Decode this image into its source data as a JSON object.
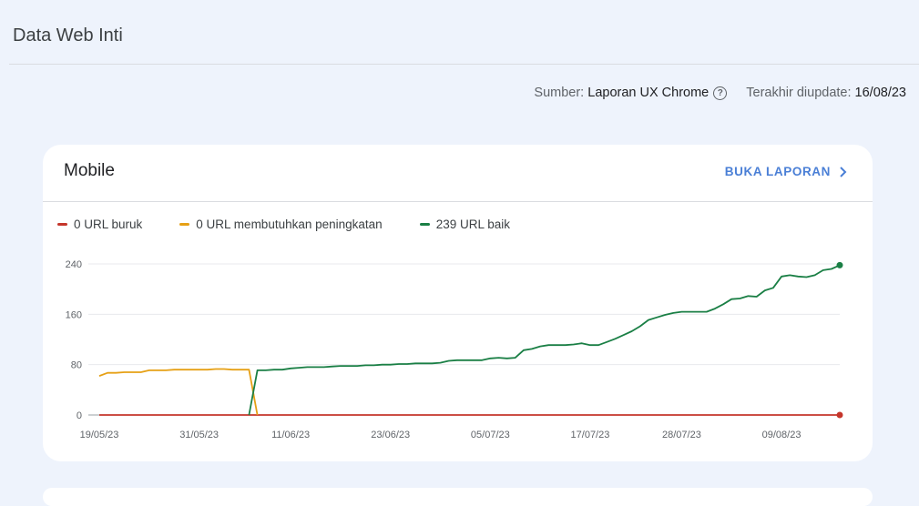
{
  "page": {
    "title": "Data Web Inti"
  },
  "meta": {
    "source_label": "Sumber:",
    "source_value": "Laporan UX Chrome",
    "updated_label": "Terakhir diupdate:",
    "updated_value": "16/08/23"
  },
  "card": {
    "title": "Mobile",
    "open_report_label": "BUKA LAPORAN",
    "legend": [
      {
        "label": "0 URL buruk",
        "color": "#c5362b"
      },
      {
        "label": "0 URL membutuhkan peningkatan",
        "color": "#e6a015"
      },
      {
        "label": "239 URL baik",
        "color": "#1a7f45"
      }
    ]
  },
  "chart_data": {
    "type": "line",
    "ylim": [
      0,
      240
    ],
    "yticks": [
      0,
      80,
      160,
      240
    ],
    "xtick_labels": [
      "19/05/23",
      "31/05/23",
      "11/06/23",
      "23/06/23",
      "05/07/23",
      "17/07/23",
      "28/07/23",
      "09/08/23"
    ],
    "xtick_days": [
      0,
      12,
      23,
      35,
      47,
      59,
      70,
      82
    ],
    "x_days": [
      0,
      1,
      2,
      3,
      4,
      5,
      6,
      7,
      8,
      9,
      10,
      11,
      12,
      13,
      14,
      15,
      16,
      17,
      18,
      19,
      20,
      21,
      22,
      23,
      24,
      25,
      26,
      27,
      28,
      29,
      30,
      31,
      32,
      33,
      34,
      35,
      36,
      37,
      38,
      39,
      40,
      41,
      42,
      43,
      44,
      45,
      46,
      47,
      48,
      49,
      50,
      51,
      52,
      53,
      54,
      55,
      56,
      57,
      58,
      59,
      60,
      61,
      62,
      63,
      64,
      65,
      66,
      67,
      68,
      69,
      70,
      71,
      72,
      73,
      74,
      75,
      76,
      77,
      78,
      79,
      80,
      81,
      82,
      83,
      84,
      85,
      86,
      87,
      88,
      89
    ],
    "series": [
      {
        "name": "0 URL buruk",
        "color": "#c5362b",
        "values": [
          0,
          0,
          0,
          0,
          0,
          0,
          0,
          0,
          0,
          0,
          0,
          0,
          0,
          0,
          0,
          0,
          0,
          0,
          0,
          0,
          0,
          0,
          0,
          0,
          0,
          0,
          0,
          0,
          0,
          0,
          0,
          0,
          0,
          0,
          0,
          0,
          0,
          0,
          0,
          0,
          0,
          0,
          0,
          0,
          0,
          0,
          0,
          0,
          0,
          0,
          0,
          0,
          0,
          0,
          0,
          0,
          0,
          0,
          0,
          0,
          0,
          0,
          0,
          0,
          0,
          0,
          0,
          0,
          0,
          0,
          0,
          0,
          0,
          0,
          0,
          0,
          0,
          0,
          0,
          0,
          0,
          0,
          0,
          0,
          0,
          0,
          0,
          0,
          0,
          0
        ]
      },
      {
        "name": "0 URL membutuhkan peningkatan",
        "color": "#e6a015",
        "values": [
          62,
          67,
          67,
          68,
          68,
          68,
          71,
          71,
          71,
          72,
          72,
          72,
          72,
          72,
          73,
          73,
          72,
          72,
          72,
          0,
          null,
          null,
          null,
          null,
          null,
          null,
          null,
          null,
          null,
          null,
          null,
          null,
          null,
          null,
          null,
          null,
          null,
          null,
          null,
          null,
          null,
          null,
          null,
          null,
          null,
          null,
          null,
          null,
          null,
          null,
          null,
          null,
          null,
          null,
          null,
          null,
          null,
          null,
          null,
          null,
          null,
          null,
          null,
          null,
          null,
          null,
          null,
          null,
          null,
          null,
          null,
          null,
          null,
          null,
          null,
          null,
          null,
          null,
          null,
          null,
          null,
          null,
          null,
          null,
          null,
          null,
          null,
          null,
          null,
          null
        ]
      },
      {
        "name": "239 URL baik",
        "color": "#1a7f45",
        "values": [
          null,
          null,
          null,
          null,
          null,
          null,
          null,
          null,
          null,
          null,
          null,
          null,
          null,
          null,
          null,
          null,
          null,
          null,
          0,
          71,
          71,
          72,
          72,
          74,
          75,
          76,
          76,
          76,
          77,
          78,
          78,
          78,
          79,
          79,
          80,
          80,
          81,
          81,
          82,
          82,
          82,
          83,
          86,
          87,
          87,
          87,
          87,
          90,
          91,
          90,
          91,
          103,
          105,
          109,
          111,
          111,
          111,
          112,
          114,
          111,
          111,
          116,
          121,
          127,
          133,
          141,
          151,
          155,
          159,
          162,
          164,
          164,
          164,
          164,
          169,
          176,
          184,
          185,
          189,
          188,
          198,
          202,
          220,
          222,
          220,
          219,
          222,
          230,
          232,
          238
        ]
      }
    ]
  }
}
